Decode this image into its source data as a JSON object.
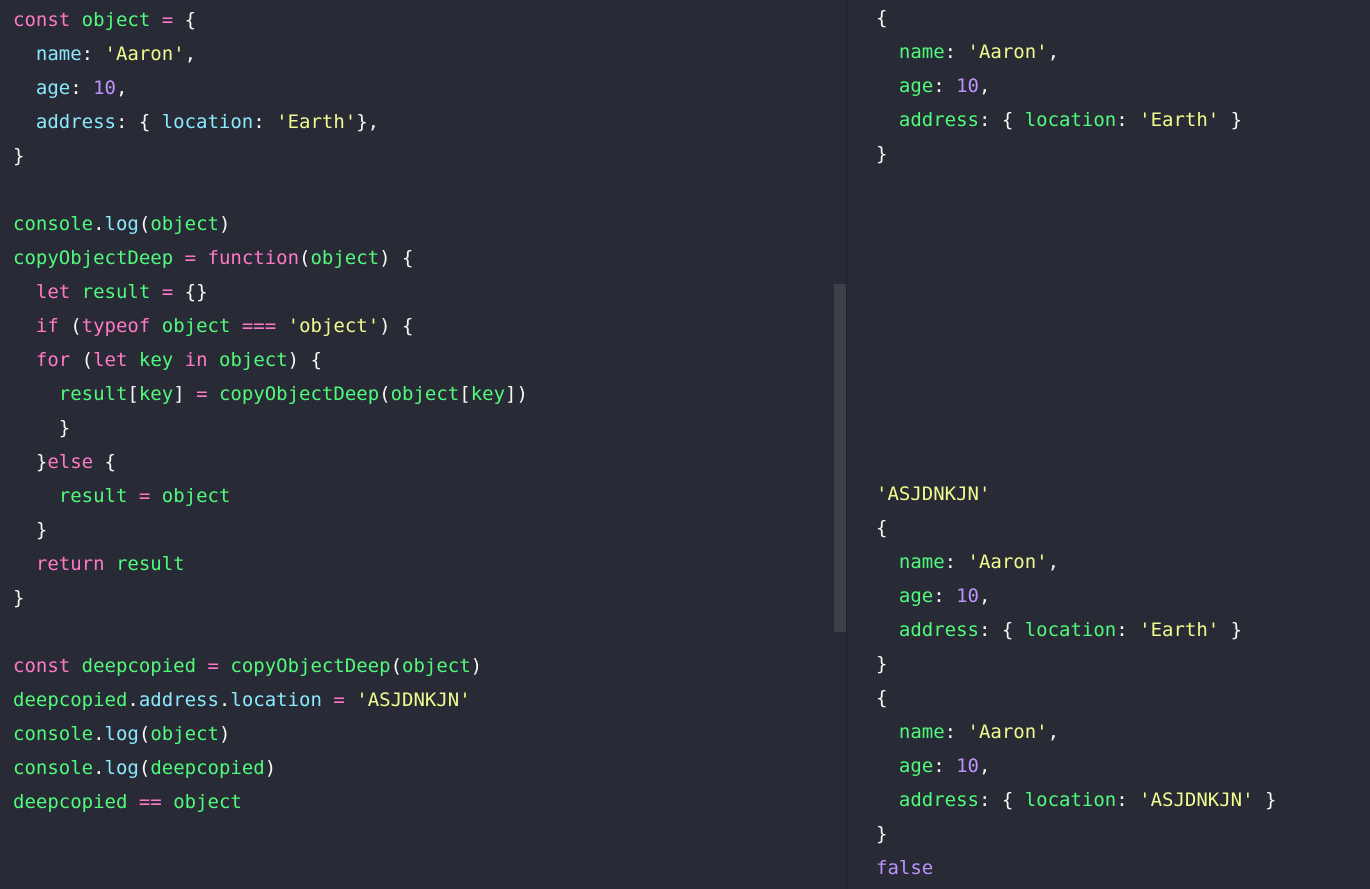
{
  "theme": {
    "background": "#282a36",
    "keyword": "#ff79c6",
    "identifier": "#50fa7b",
    "property": "#8be9fd",
    "string": "#f1fa8c",
    "number": "#bd93f9",
    "text": "#f8f8f2"
  },
  "editor": {
    "lines": [
      [
        [
          "kw",
          "const"
        ],
        [
          "t",
          " "
        ],
        [
          "id",
          "object"
        ],
        [
          "t",
          " "
        ],
        [
          "op",
          "="
        ],
        [
          "t",
          " "
        ],
        [
          "p",
          "{"
        ]
      ],
      [
        [
          "t",
          "  "
        ],
        [
          "prop",
          "name"
        ],
        [
          "p",
          ": "
        ],
        [
          "str",
          "'Aaron'"
        ],
        [
          "p",
          ","
        ]
      ],
      [
        [
          "t",
          "  "
        ],
        [
          "prop",
          "age"
        ],
        [
          "p",
          ": "
        ],
        [
          "num",
          "10"
        ],
        [
          "p",
          ","
        ]
      ],
      [
        [
          "t",
          "  "
        ],
        [
          "prop",
          "address"
        ],
        [
          "p",
          ": { "
        ],
        [
          "prop",
          "location"
        ],
        [
          "p",
          ": "
        ],
        [
          "str",
          "'Earth'"
        ],
        [
          "p",
          "},"
        ]
      ],
      [
        [
          "p",
          "}"
        ]
      ],
      [],
      [
        [
          "id",
          "console"
        ],
        [
          "p",
          "."
        ],
        [
          "method",
          "log"
        ],
        [
          "p",
          "("
        ],
        [
          "id",
          "object"
        ],
        [
          "p",
          ")"
        ]
      ],
      [
        [
          "id",
          "copyObjectDeep"
        ],
        [
          "t",
          " "
        ],
        [
          "op",
          "="
        ],
        [
          "t",
          " "
        ],
        [
          "kw",
          "function"
        ],
        [
          "p",
          "("
        ],
        [
          "id",
          "object"
        ],
        [
          "p",
          ") {"
        ]
      ],
      [
        [
          "t",
          "  "
        ],
        [
          "kw",
          "let"
        ],
        [
          "t",
          " "
        ],
        [
          "id",
          "result"
        ],
        [
          "t",
          " "
        ],
        [
          "op",
          "="
        ],
        [
          "t",
          " "
        ],
        [
          "p",
          "{}"
        ]
      ],
      [
        [
          "t",
          "  "
        ],
        [
          "kw",
          "if"
        ],
        [
          "p",
          " ("
        ],
        [
          "kw",
          "typeof"
        ],
        [
          "t",
          " "
        ],
        [
          "id",
          "object"
        ],
        [
          "t",
          " "
        ],
        [
          "op",
          "==="
        ],
        [
          "t",
          " "
        ],
        [
          "str",
          "'object'"
        ],
        [
          "p",
          ") {"
        ]
      ],
      [
        [
          "t",
          "  "
        ],
        [
          "kw",
          "for"
        ],
        [
          "p",
          " ("
        ],
        [
          "kw",
          "let"
        ],
        [
          "t",
          " "
        ],
        [
          "id",
          "key"
        ],
        [
          "t",
          " "
        ],
        [
          "kw",
          "in"
        ],
        [
          "t",
          " "
        ],
        [
          "id",
          "object"
        ],
        [
          "p",
          ") {"
        ]
      ],
      [
        [
          "t",
          "    "
        ],
        [
          "id",
          "result"
        ],
        [
          "p",
          "["
        ],
        [
          "id",
          "key"
        ],
        [
          "p",
          "] "
        ],
        [
          "op",
          "="
        ],
        [
          "t",
          " "
        ],
        [
          "fn",
          "copyObjectDeep"
        ],
        [
          "p",
          "("
        ],
        [
          "id",
          "object"
        ],
        [
          "p",
          "["
        ],
        [
          "id",
          "key"
        ],
        [
          "p",
          "])"
        ]
      ],
      [
        [
          "t",
          "    "
        ],
        [
          "p",
          "}"
        ]
      ],
      [
        [
          "t",
          "  "
        ],
        [
          "p",
          "}"
        ],
        [
          "kw",
          "else"
        ],
        [
          "p",
          " {"
        ]
      ],
      [
        [
          "t",
          "    "
        ],
        [
          "id",
          "result"
        ],
        [
          "t",
          " "
        ],
        [
          "op",
          "="
        ],
        [
          "t",
          " "
        ],
        [
          "id",
          "object"
        ]
      ],
      [
        [
          "t",
          "  "
        ],
        [
          "p",
          "}"
        ]
      ],
      [
        [
          "t",
          "  "
        ],
        [
          "kw",
          "return"
        ],
        [
          "t",
          " "
        ],
        [
          "id",
          "result"
        ]
      ],
      [
        [
          "p",
          "}"
        ]
      ],
      [],
      [
        [
          "kw",
          "const"
        ],
        [
          "t",
          " "
        ],
        [
          "id",
          "deepcopied"
        ],
        [
          "t",
          " "
        ],
        [
          "op",
          "="
        ],
        [
          "t",
          " "
        ],
        [
          "fn",
          "copyObjectDeep"
        ],
        [
          "p",
          "("
        ],
        [
          "id",
          "object"
        ],
        [
          "p",
          ")"
        ]
      ],
      [
        [
          "id",
          "deepcopied"
        ],
        [
          "p",
          "."
        ],
        [
          "prop",
          "address"
        ],
        [
          "p",
          "."
        ],
        [
          "prop",
          "location"
        ],
        [
          "t",
          " "
        ],
        [
          "op",
          "="
        ],
        [
          "t",
          " "
        ],
        [
          "str",
          "'ASJDNKJN'"
        ]
      ],
      [
        [
          "id",
          "console"
        ],
        [
          "p",
          "."
        ],
        [
          "method",
          "log"
        ],
        [
          "p",
          "("
        ],
        [
          "id",
          "object"
        ],
        [
          "p",
          ")"
        ]
      ],
      [
        [
          "id",
          "console"
        ],
        [
          "p",
          "."
        ],
        [
          "method",
          "log"
        ],
        [
          "p",
          "("
        ],
        [
          "id",
          "deepcopied"
        ],
        [
          "p",
          ")"
        ]
      ],
      [
        [
          "id",
          "deepcopied"
        ],
        [
          "t",
          " "
        ],
        [
          "op",
          "=="
        ],
        [
          "t",
          " "
        ],
        [
          "id",
          "object"
        ]
      ]
    ]
  },
  "output": {
    "lines": [
      [
        [
          "p",
          "{"
        ]
      ],
      [
        [
          "t",
          "  "
        ],
        [
          "okey",
          "name"
        ],
        [
          "p",
          ": "
        ],
        [
          "str",
          "'Aaron'"
        ],
        [
          "p",
          ","
        ]
      ],
      [
        [
          "t",
          "  "
        ],
        [
          "okey",
          "age"
        ],
        [
          "p",
          ": "
        ],
        [
          "num",
          "10"
        ],
        [
          "p",
          ","
        ]
      ],
      [
        [
          "t",
          "  "
        ],
        [
          "okey",
          "address"
        ],
        [
          "p",
          ": { "
        ],
        [
          "okey",
          "location"
        ],
        [
          "p",
          ": "
        ],
        [
          "str",
          "'Earth'"
        ],
        [
          "p",
          " }"
        ]
      ],
      [
        [
          "p",
          "}"
        ]
      ],
      [],
      [],
      [],
      [],
      [],
      [],
      [],
      [],
      [],
      [
        [
          "str",
          "'ASJDNKJN'"
        ]
      ],
      [
        [
          "p",
          "{"
        ]
      ],
      [
        [
          "t",
          "  "
        ],
        [
          "okey",
          "name"
        ],
        [
          "p",
          ": "
        ],
        [
          "str",
          "'Aaron'"
        ],
        [
          "p",
          ","
        ]
      ],
      [
        [
          "t",
          "  "
        ],
        [
          "okey",
          "age"
        ],
        [
          "p",
          ": "
        ],
        [
          "num",
          "10"
        ],
        [
          "p",
          ","
        ]
      ],
      [
        [
          "t",
          "  "
        ],
        [
          "okey",
          "address"
        ],
        [
          "p",
          ": { "
        ],
        [
          "okey",
          "location"
        ],
        [
          "p",
          ": "
        ],
        [
          "str",
          "'Earth'"
        ],
        [
          "p",
          " }"
        ]
      ],
      [
        [
          "p",
          "}"
        ]
      ],
      [
        [
          "p",
          "{"
        ]
      ],
      [
        [
          "t",
          "  "
        ],
        [
          "okey",
          "name"
        ],
        [
          "p",
          ": "
        ],
        [
          "str",
          "'Aaron'"
        ],
        [
          "p",
          ","
        ]
      ],
      [
        [
          "t",
          "  "
        ],
        [
          "okey",
          "age"
        ],
        [
          "p",
          ": "
        ],
        [
          "num",
          "10"
        ],
        [
          "p",
          ","
        ]
      ],
      [
        [
          "t",
          "  "
        ],
        [
          "okey",
          "address"
        ],
        [
          "p",
          ": { "
        ],
        [
          "okey",
          "location"
        ],
        [
          "p",
          ": "
        ],
        [
          "str",
          "'ASJDNKJN'"
        ],
        [
          "p",
          " }"
        ]
      ],
      [
        [
          "p",
          "}"
        ]
      ],
      [
        [
          "bool",
          "false"
        ]
      ]
    ]
  }
}
